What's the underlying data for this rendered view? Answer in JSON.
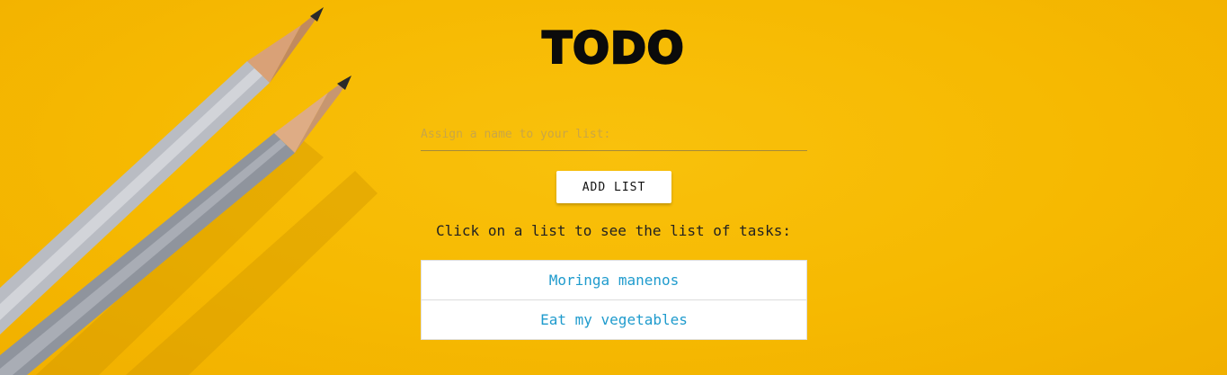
{
  "app": {
    "title": "TODO"
  },
  "form": {
    "placeholder": "Assign a name to your list:",
    "value": "",
    "add_label": "ADD LIST"
  },
  "hint": "Click on a list to see the list of tasks:",
  "lists": [
    {
      "label": "Moringa manenos"
    },
    {
      "label": "Eat my vegetables"
    }
  ],
  "colors": {
    "background": "#f6b901",
    "link": "#1f9bcd",
    "title": "#0b0b0b"
  }
}
